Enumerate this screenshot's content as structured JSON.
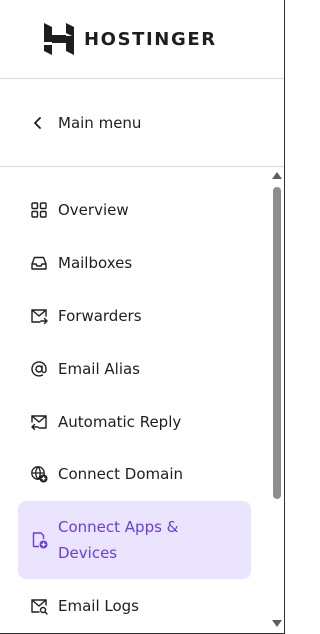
{
  "brand": {
    "name": "HOSTINGER"
  },
  "nav": {
    "back_label": "Main menu"
  },
  "menu": {
    "items": [
      {
        "label": "Overview",
        "icon": "grid-icon"
      },
      {
        "label": "Mailboxes",
        "icon": "inbox-icon"
      },
      {
        "label": "Forwarders",
        "icon": "mail-forward-icon"
      },
      {
        "label": "Email Alias",
        "icon": "at-sign-icon"
      },
      {
        "label": "Automatic Reply",
        "icon": "mail-reply-icon"
      },
      {
        "label": "Connect Domain",
        "icon": "globe-plus-icon"
      },
      {
        "label": "Connect Apps & Devices",
        "icon": "device-plus-icon",
        "active": true
      },
      {
        "label": "Email Logs",
        "icon": "mail-search-icon"
      }
    ]
  },
  "colors": {
    "accent": "#673de6",
    "active_bg": "#ebe4ff",
    "text": "#1d1e20",
    "divider": "#dadce0"
  }
}
